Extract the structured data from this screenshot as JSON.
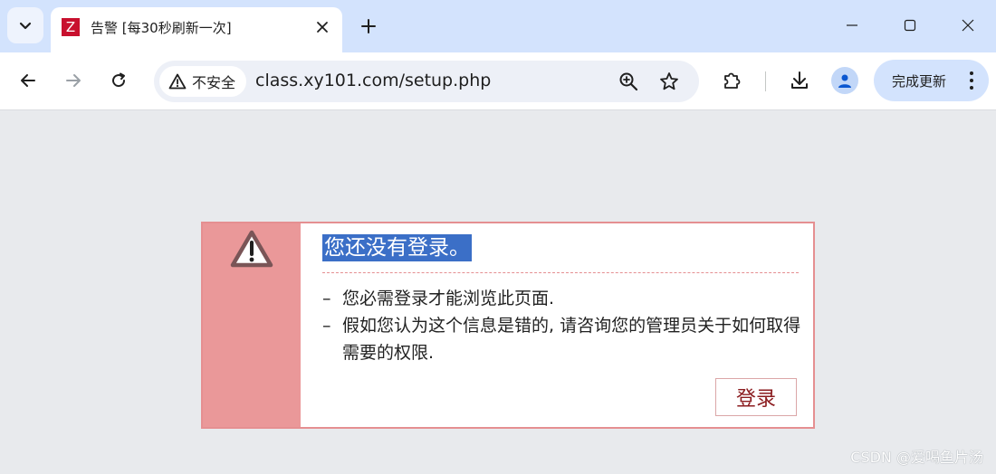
{
  "browser": {
    "tab": {
      "favicon_letter": "Z",
      "favicon_color": "#c8102e",
      "title": "告警 [每30秒刷新一次]"
    },
    "omnibox": {
      "security_label": "不安全",
      "url": "class.xy101.com/setup.php"
    },
    "update_button": {
      "label": "完成更新"
    },
    "accent_color": "#d3e3fd"
  },
  "alert": {
    "heading": "您还没有登录。",
    "messages": [
      "您必需登录才能浏览此页面.",
      "假如您认为这个信息是错的, 请咨询您的管理员关于如何取得需要的权限."
    ],
    "login_button": "登录",
    "side_color": "#ea9899"
  },
  "watermark": "CSDN @爱喝鱼片汤"
}
